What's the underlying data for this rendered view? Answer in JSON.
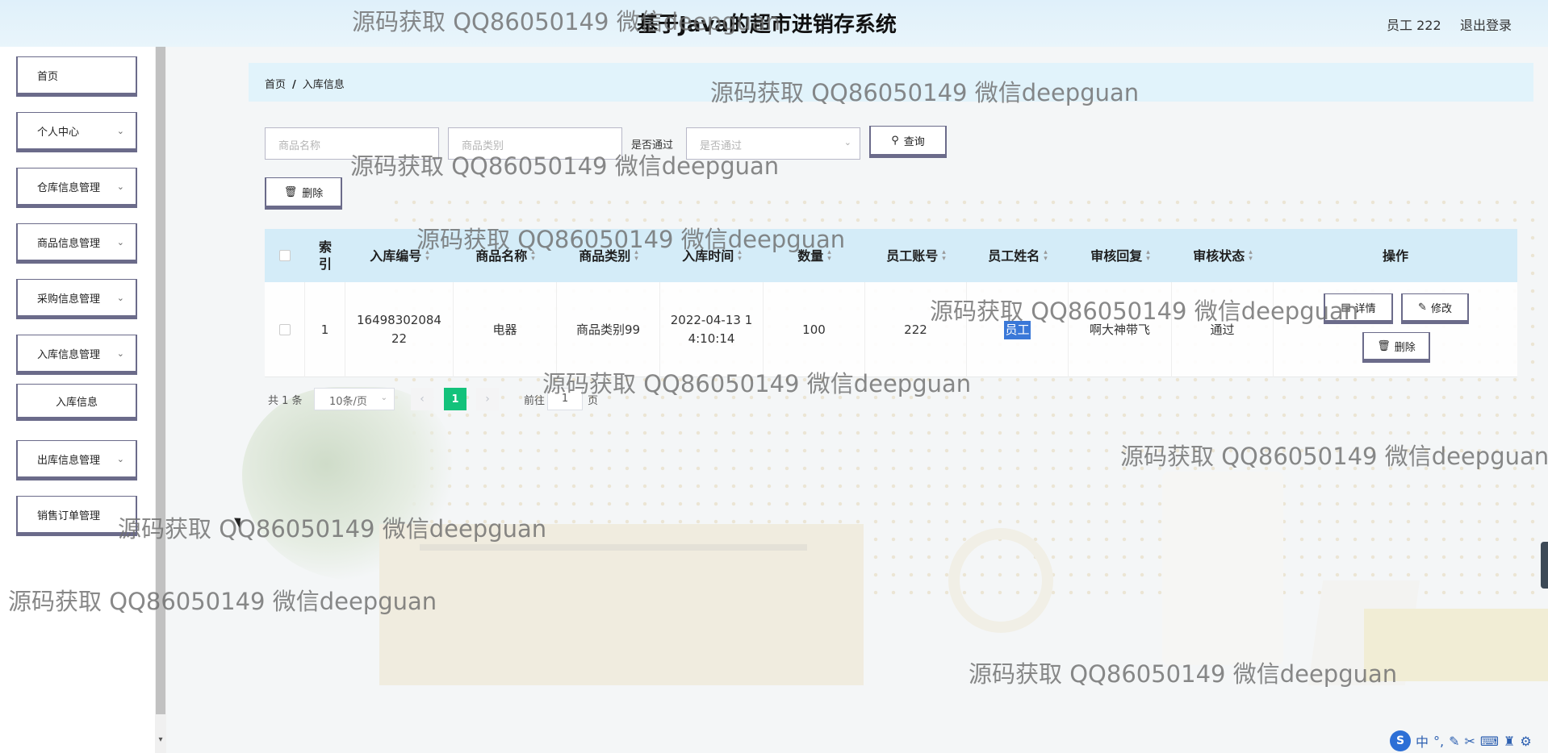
{
  "header": {
    "title": "基于Java的超市进销存系统",
    "user": "员工 222",
    "logout": "退出登录"
  },
  "sidebar": {
    "items": [
      {
        "label": "首页",
        "has_chevron": false
      },
      {
        "label": "个人中心",
        "has_chevron": true
      },
      {
        "label": "仓库信息管理",
        "has_chevron": true
      },
      {
        "label": "商品信息管理",
        "has_chevron": true
      },
      {
        "label": "采购信息管理",
        "has_chevron": true
      },
      {
        "label": "入库信息管理",
        "has_chevron": true
      },
      {
        "label": "入库信息",
        "has_chevron": false
      },
      {
        "label": "出库信息管理",
        "has_chevron": true
      },
      {
        "label": "销售订单管理",
        "has_chevron": false
      }
    ]
  },
  "breadcrumb": {
    "home": "首页",
    "separator": "/",
    "current": "入库信息"
  },
  "search": {
    "name_placeholder": "商品名称",
    "category_placeholder": "商品类别",
    "pass_label": "是否通过",
    "pass_placeholder": "是否通过",
    "query_label": "查询"
  },
  "toolbar": {
    "delete_label": "删除"
  },
  "table": {
    "columns": [
      "索引",
      "入库编号",
      "商品名称",
      "商品类别",
      "入库时间",
      "数量",
      "员工账号",
      "员工姓名",
      "审核回复",
      "审核状态",
      "操作"
    ],
    "rows": [
      {
        "index": "1",
        "code": "1649830208422",
        "name": "电器",
        "category": "商品类别99",
        "time": "2022-04-13 14:10:14",
        "quantity": "100",
        "account": "222",
        "employee_name": "员工",
        "reply": "啊大神带飞",
        "status": "通过",
        "actions": {
          "detail": "详情",
          "edit": "修改",
          "delete": "删除"
        }
      }
    ]
  },
  "pagination": {
    "total": "共 1 条",
    "page_size": "10条/页",
    "current_page": "1",
    "goto_label": "前往",
    "goto_value": "1",
    "goto_unit": "页"
  },
  "watermark": "源码获取 QQ86050149 微信deepguan",
  "ime": {
    "lang": "中",
    "logo": "S"
  },
  "colors": {
    "accent": "#13c27b",
    "header_bg": "#d4ecf8",
    "button_border": "#6b6b8a",
    "breadcrumb_bg": "#e1f3fb"
  }
}
